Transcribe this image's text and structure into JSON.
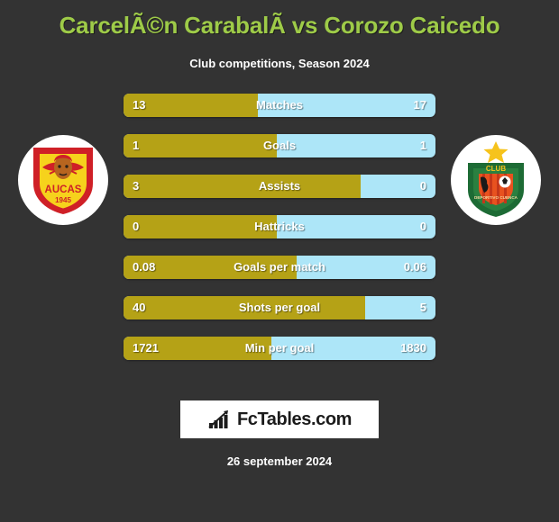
{
  "header": {
    "title": "CarcelÃ©n CarabalÃ­ vs Corozo Caicedo",
    "subtitle": "Club competitions, Season 2024",
    "title_color": "#9ecb48"
  },
  "teams": {
    "home": {
      "crest_name": "aucas-crest",
      "crest_label": "AUCAS",
      "crest_year": "1945",
      "colors": {
        "shield": "#cf2027",
        "inner": "#f6d21c"
      }
    },
    "away": {
      "crest_name": "deportivo-cuenca-crest",
      "crest_label": "CLUB",
      "crest_sub": "DEPORTIVO CUENCA",
      "colors": {
        "shield": "#1d6b35",
        "stripes": "#e8521f",
        "star": "#f6c31c"
      }
    }
  },
  "colors": {
    "background": "#333333",
    "home_bar": "#b5a216",
    "away_bar": "#ade6f8",
    "text": "#ffffff"
  },
  "chart_data": {
    "type": "bar",
    "title": "CarcelÃ©n CarabalÃ­ vs Corozo Caicedo",
    "subtitle": "Club competitions, Season 2024",
    "orientation": "horizontal-diverging",
    "categories": [
      "Matches",
      "Goals",
      "Assists",
      "Hattricks",
      "Goals per match",
      "Shots per goal",
      "Min per goal"
    ],
    "series": [
      {
        "name": "CarcelÃ©n CarabalÃ­",
        "color": "#b5a216",
        "values": [
          13,
          1,
          3,
          0,
          0.08,
          40,
          1721
        ]
      },
      {
        "name": "Corozo Caicedo",
        "color": "#ade6f8",
        "values": [
          17,
          1,
          0,
          0,
          0.06,
          5,
          1830
        ]
      }
    ],
    "rows": [
      {
        "label": "Matches",
        "home": "13",
        "away": "17",
        "home_pct": 43.0
      },
      {
        "label": "Goals",
        "home": "1",
        "away": "1",
        "home_pct": 49.0
      },
      {
        "label": "Assists",
        "home": "3",
        "away": "0",
        "home_pct": 76.0
      },
      {
        "label": "Hattricks",
        "home": "0",
        "away": "0",
        "home_pct": 49.0
      },
      {
        "label": "Goals per match",
        "home": "0.08",
        "away": "0.06",
        "home_pct": 55.5
      },
      {
        "label": "Shots per goal",
        "home": "40",
        "away": "5",
        "home_pct": 77.5
      },
      {
        "label": "Min per goal",
        "home": "1721",
        "away": "1830",
        "home_pct": 47.5
      }
    ],
    "grid": false,
    "legend": "none"
  },
  "footer": {
    "brand_text": "FcTables.com",
    "brand_icon": "bar-chart-icon",
    "date": "26 september 2024"
  }
}
